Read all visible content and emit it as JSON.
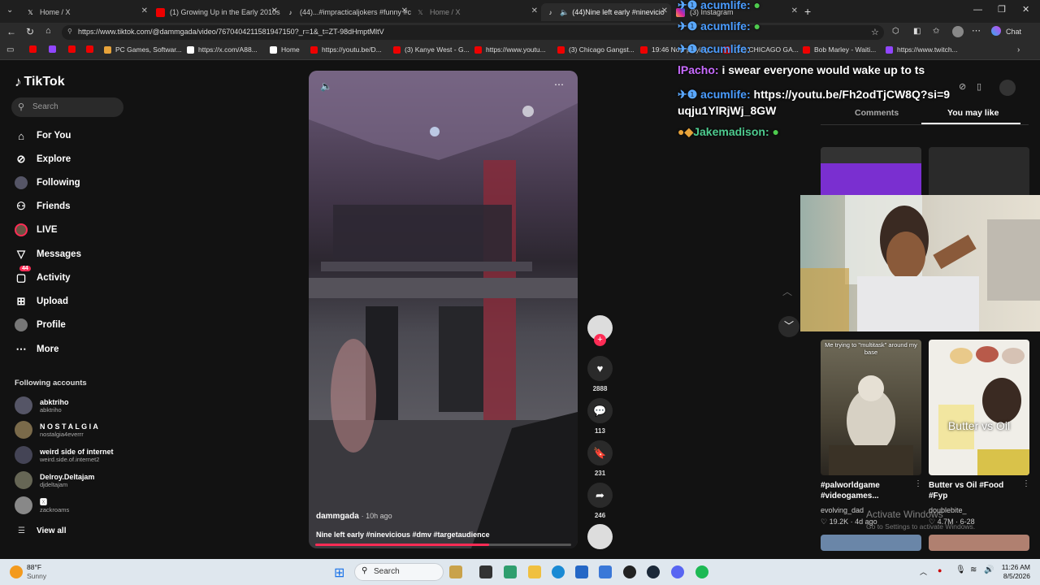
{
  "tabs": [
    {
      "label": "Home / X",
      "icon": "x-icon"
    },
    {
      "label": "(1) Growing Up in the Early 2010s",
      "icon": "youtube-icon"
    },
    {
      "label": "(44)...#impracticaljokers #funny #c",
      "icon": "tiktok-icon"
    },
    {
      "label": "Home / X",
      "icon": "x-icon"
    },
    {
      "label": "(44)Nine left early #ninevicio",
      "icon": "tiktok-icon"
    },
    {
      "label": "(3) Instagram",
      "icon": "instagram-icon"
    }
  ],
  "address": {
    "url": "https://www.tiktok.com/@dammgada/video/7670404211581947150?_r=1&_t=ZT-98dHmptMltV"
  },
  "toolbar": {
    "chat_label": "Chat"
  },
  "bookmarks": [
    "PC Games, Softwar...",
    "https://x.com/A88...",
    "Home",
    "https://youtu.be/D...",
    "(3) Kanye West - G...",
    "https://www.youtu...",
    "(3) Chicago Gangst...",
    "19:46 Now playing...",
    "(12) CHICAGO GA...",
    "Bob Marley - Waiti...",
    "https://www.twitch..."
  ],
  "tiktok": {
    "logo": "TikTok",
    "search_placeholder": "Search",
    "nav": [
      "For You",
      "Explore",
      "Following",
      "Friends",
      "LIVE",
      "Messages",
      "Activity",
      "Upload",
      "Profile",
      "More"
    ],
    "activity_badge": "44",
    "following_header": "Following accounts",
    "accounts": [
      {
        "name": "abktriho",
        "handle": "abktriho"
      },
      {
        "name": "N O S T A L G I A",
        "handle": "nostalgia4everrr"
      },
      {
        "name": "weird side of internet",
        "handle": "weird.side.of.internet2"
      },
      {
        "name": "Delroy.Deltajam",
        "handle": "djdeltajam"
      },
      {
        "name": "🆇",
        "handle": "zackroams"
      }
    ],
    "view_all": "View all",
    "video": {
      "author": "dammgada",
      "time": "· 10h ago",
      "caption": "Nine left early #ninevicious #dmv #targetaudience",
      "progress": 0.68
    },
    "actions": {
      "likes": "2888",
      "comments": "113",
      "saves": "231",
      "shares": "246"
    },
    "right_tabs": {
      "comments": "Comments",
      "you_may_like": "You may like"
    },
    "recs": [
      {
        "overlay": "Me trying to \"multitask\" around my base",
        "caption": "#palworldgame #videogames...",
        "author": "evolving_dad",
        "stats": "♡ 19.2K · 4d ago"
      },
      {
        "overlay": "Butter vs Oil",
        "caption": "Butter vs Oil #Food #Fyp",
        "author": "doublebite_",
        "stats": "♡ 4.7M · 6-28"
      }
    ]
  },
  "chat": [
    {
      "user": "acumlife:",
      "text": "",
      "color": "#4a9cff"
    },
    {
      "user": "acumlife:",
      "text": "",
      "color": "#4a9cff"
    },
    {
      "user": "acumlife:",
      "text": "",
      "color": "#4a9cff"
    },
    {
      "user": "lPacho:",
      "text": "i swear everyone would wake up to ts",
      "color": "#c86bff"
    },
    {
      "user": "acumlife:",
      "text": "https://youtu.be/Fh2odTjCW8Q?si=9uqju1YlRjWj_8GW",
      "color": "#4a9cff"
    },
    {
      "user": "Jakemadison:",
      "text": "",
      "color": "#4ecb8f"
    }
  ],
  "watermark": {
    "title": "Activate Windows",
    "sub": "Go to Settings to activate Windows."
  },
  "taskbar": {
    "temp": "88°F",
    "weather": "Sunny",
    "search": "Search",
    "time": "11:26 AM",
    "date": "8/5/2026"
  }
}
